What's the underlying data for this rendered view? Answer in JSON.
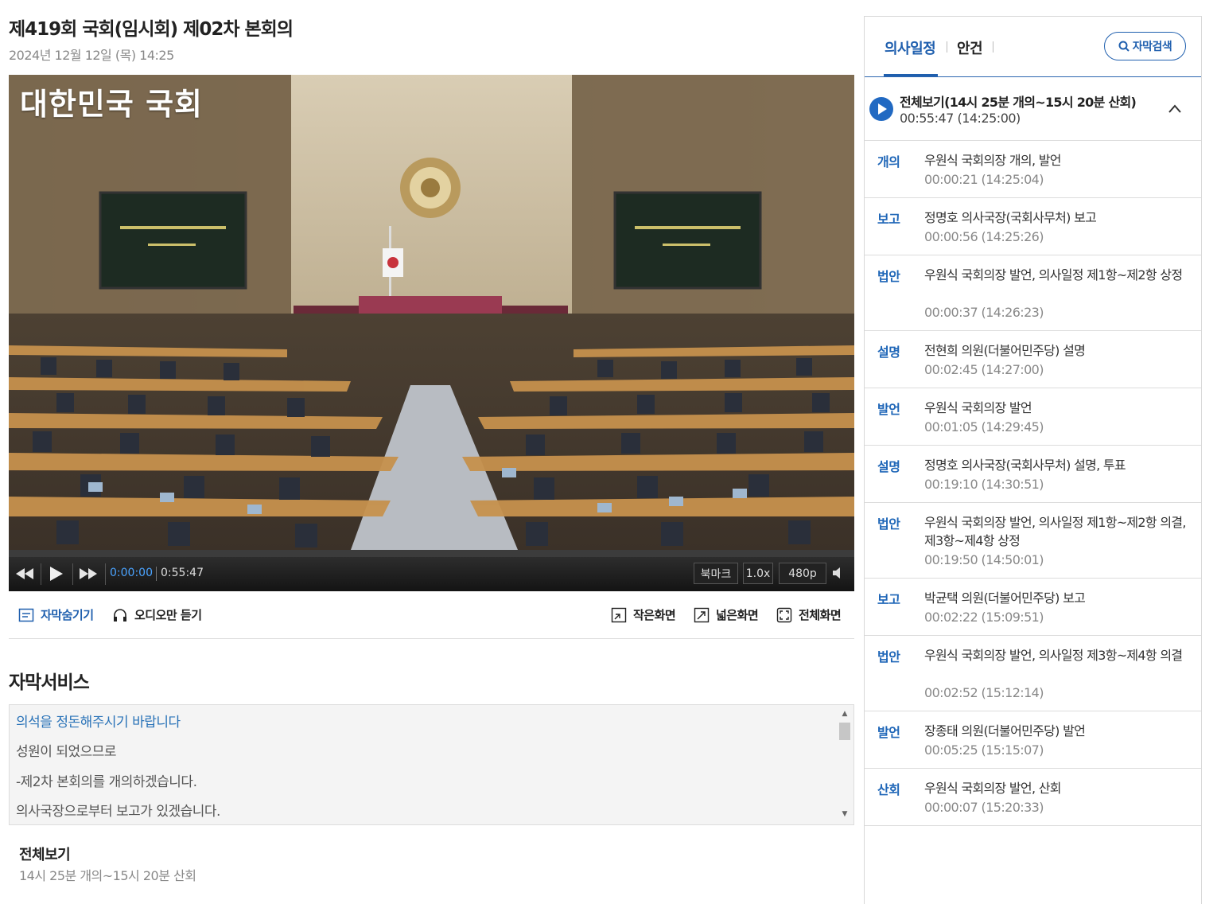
{
  "header": {
    "title": "제419회 국회(임시회) 제02차 본회의",
    "date": "2024년 12월 12일 (목) 14:25"
  },
  "video": {
    "watermark": "대한민국 국회",
    "progress_fraction": 0.0
  },
  "player": {
    "current_time": "0:00:00",
    "total_time": "0:55:47",
    "bookmark_label": "북마크",
    "speed_label": "1.0x",
    "quality_label": "480p",
    "icons": [
      "rewind-icon",
      "play-icon",
      "fast-forward-icon",
      "volume-icon"
    ]
  },
  "options": {
    "hide_captions": "자막숨기기",
    "audio_only": "오디오만 듣기",
    "small_screen": "작은화면",
    "wide_screen": "넓은화면",
    "full_screen": "전체화면"
  },
  "captions": {
    "title": "자막서비스",
    "lines": [
      "의석을 정돈해주시기 바랍니다",
      "성원이 되었으므로",
      "-제2차 본회의를 개의하겠습니다.",
      "의사국장으로부터 보고가 있겠습니다."
    ],
    "active_index": 0
  },
  "bottom": {
    "title": "전체보기",
    "subtitle": "14시 25분 개의~15시 20분 산회"
  },
  "sidebar": {
    "tabs": [
      "의사일정",
      "안건"
    ],
    "active_tab": 0,
    "search_label": "자막검색",
    "overview": {
      "title": "전체보기(14시 25분 개의~15시 20분 산회)",
      "time": "00:55:47 (14:25:00)"
    },
    "agenda": [
      {
        "type": "개의",
        "desc": "우원식 국회의장 개의, 발언",
        "time": "00:00:21 (14:25:04)"
      },
      {
        "type": "보고",
        "desc": "정명호 의사국장(국회사무처) 보고",
        "time": "00:00:56 (14:25:26)"
      },
      {
        "type": "법안",
        "desc": "우원식 국회의장 발언, 의사일정 제1항~제2항 상정",
        "time": "00:00:37 (14:26:23)"
      },
      {
        "type": "설명",
        "desc": "전현희 의원(더불어민주당) 설명",
        "time": "00:02:45 (14:27:00)"
      },
      {
        "type": "발언",
        "desc": "우원식 국회의장 발언",
        "time": "00:01:05 (14:29:45)"
      },
      {
        "type": "설명",
        "desc": "정명호 의사국장(국회사무처) 설명, 투표",
        "time": "00:19:10 (14:30:51)"
      },
      {
        "type": "법안",
        "desc": "우원식 국회의장 발언, 의사일정 제1항~제2항 의결, 제3항~제4항 상정",
        "time": "00:19:50 (14:50:01)"
      },
      {
        "type": "보고",
        "desc": "박균택 의원(더불어민주당) 보고",
        "time": "00:02:22 (15:09:51)"
      },
      {
        "type": "법안",
        "desc": "우원식 국회의장 발언, 의사일정 제3항~제4항 의결",
        "time": "00:02:52 (15:12:14)"
      },
      {
        "type": "발언",
        "desc": "장종태 의원(더불어민주당) 발언",
        "time": "00:05:25 (15:15:07)"
      },
      {
        "type": "산회",
        "desc": "우원식 국회의장 발언, 산회",
        "time": "00:00:07 (15:20:33)"
      }
    ]
  }
}
